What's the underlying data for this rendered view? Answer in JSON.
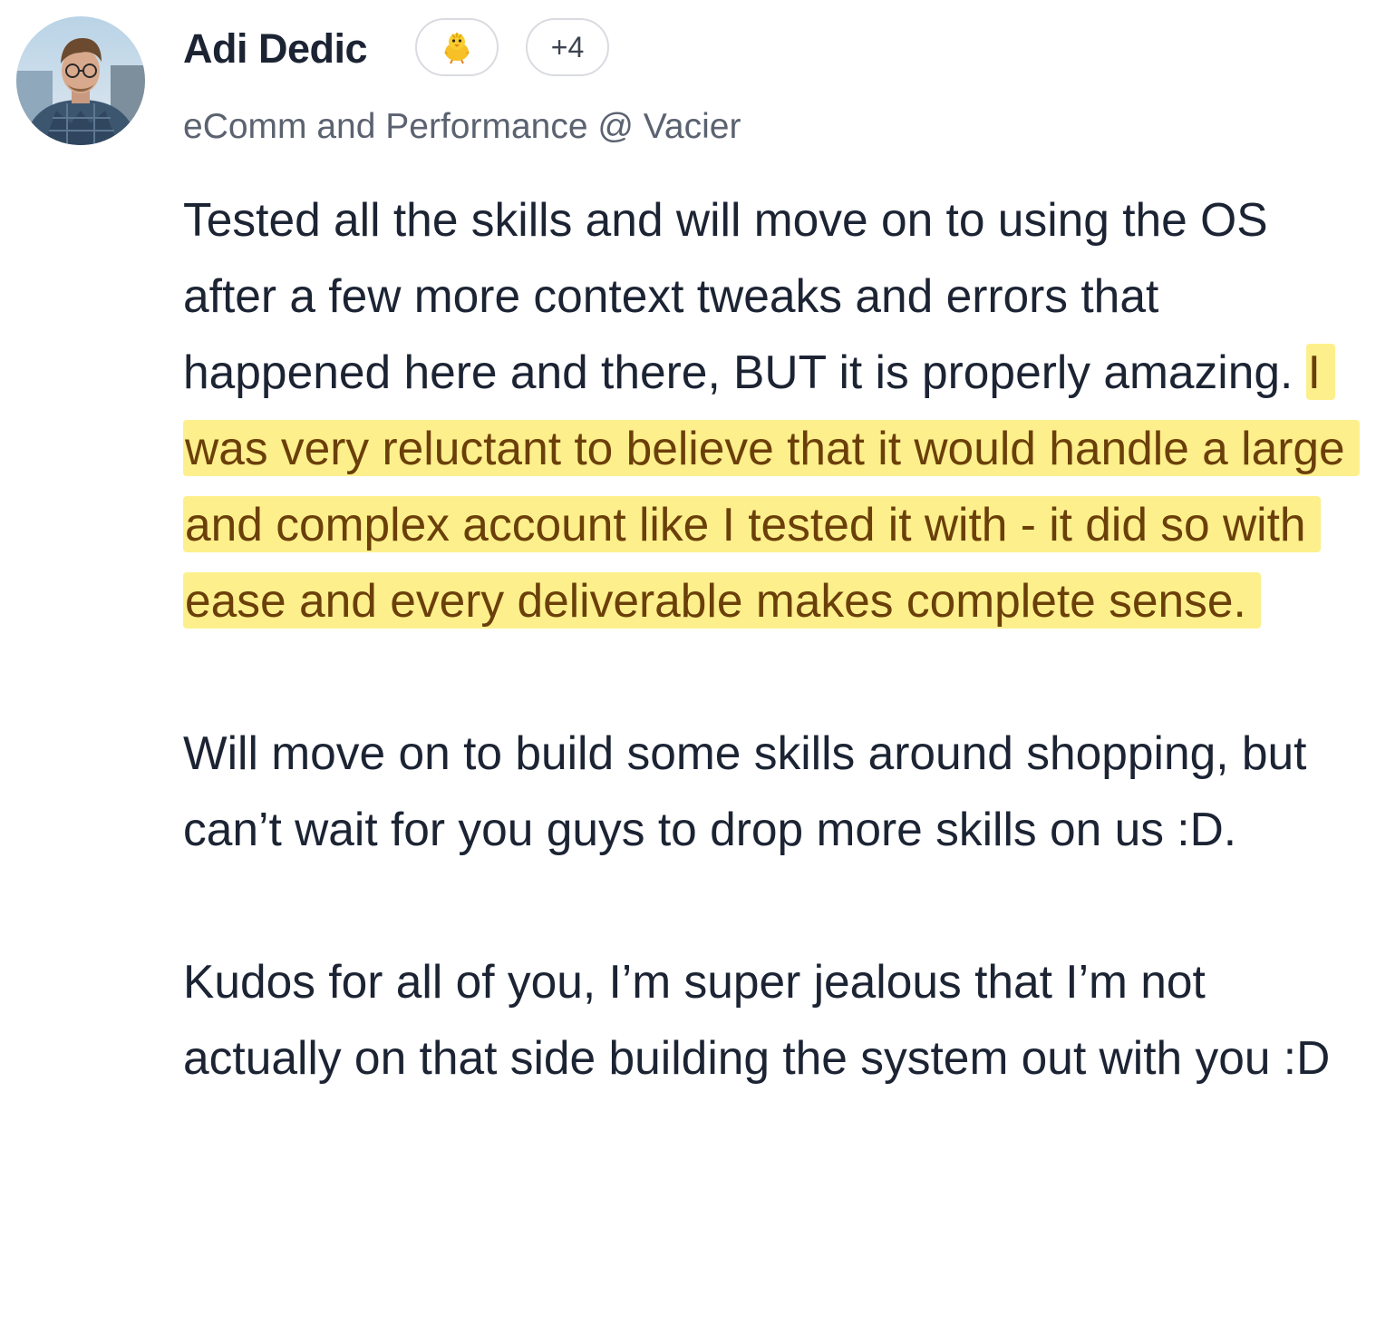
{
  "post": {
    "author": {
      "name": "Adi Dedic",
      "title": "eComm and Performance @ Vacier",
      "avatar_alt": "Profile photo of a man with glasses"
    },
    "badges": {
      "emoji": "🐥",
      "more_count": "+4"
    },
    "body": {
      "p1_before": "Tested all the skills and will move on to using the OS after a few more context tweaks and errors that happened here and there, BUT it is properly amazing. ",
      "p1_highlight": "I was very reluctant to believe that it would handle a large and complex account like I tested it with - it did so with ease and every deliverable makes complete sense.",
      "p2": "Will move on to build some skills around shopping, but can’t wait for you guys to drop more skills on us :D.",
      "p3": "Kudos for all of you, I’m super jealous that I’m not actually on that side building the system out with you :D"
    },
    "colors": {
      "highlight_background": "#fdf08c",
      "highlight_text": "#6b3f0a",
      "text": "#1c2434",
      "muted_text": "#5b6270"
    }
  }
}
